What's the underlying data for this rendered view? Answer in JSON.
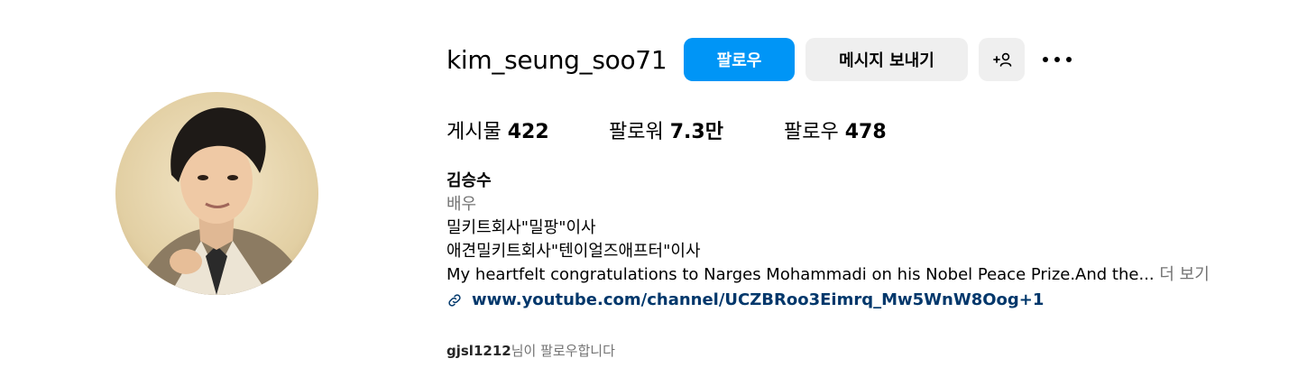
{
  "profile": {
    "username": "kim_seung_soo71",
    "follow_label": "팔로우",
    "message_label": "메시지 보내기",
    "suggest_icon": "add-person-icon",
    "more_icon": "ellipsis-icon"
  },
  "stats": {
    "posts_label": "게시물",
    "posts_value": "422",
    "followers_label": "팔로워",
    "followers_value": "7.3만",
    "following_label": "팔로우",
    "following_value": "478"
  },
  "bio": {
    "name": "김승수",
    "category": "배우",
    "line1": "밀키트회사\"밀팡\"이사",
    "line2": "애견밀키트회사\"텐이얼즈애프터\"이사",
    "line3": "My heartfelt congratulations to Narges Mohammadi on his Nobel Peace Prize.And the...",
    "more_label": "더 보기",
    "link_icon": "link-icon",
    "link": "www.youtube.com/channel/UCZBRoo3Eimrq_Mw5WnW8Oog+1"
  },
  "followed_by": {
    "user": "gjsl1212",
    "suffix": "님이 팔로우합니다"
  },
  "colors": {
    "primary_button": "#0095f6",
    "secondary_button": "#efefef",
    "muted_text": "#737373",
    "link_text": "#00376b"
  }
}
